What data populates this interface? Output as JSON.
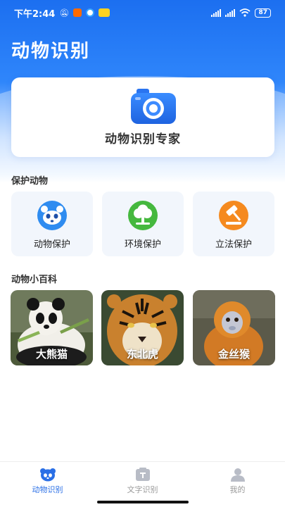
{
  "status_bar": {
    "time": "下午2:44",
    "battery": "87"
  },
  "app": {
    "title": "动物识别"
  },
  "scan": {
    "label": "动物识别专家",
    "icon": "camera-icon"
  },
  "protect_section": {
    "title": "保护动物",
    "items": [
      {
        "label": "动物保护",
        "icon": "panda-face-icon",
        "color": "#2f8cf0"
      },
      {
        "label": "环境保护",
        "icon": "tree-icon",
        "color": "#45b83e"
      },
      {
        "label": "立法保护",
        "icon": "gavel-icon",
        "color": "#f58a1f"
      }
    ]
  },
  "encyclopedia_section": {
    "title": "动物小百科",
    "items": [
      {
        "label": "大熊猫",
        "icon": "panda-photo"
      },
      {
        "label": "东北虎",
        "icon": "tiger-photo"
      },
      {
        "label": "金丝猴",
        "icon": "golden-monkey-photo"
      }
    ]
  },
  "tabbar": {
    "tabs": [
      {
        "label": "动物识别",
        "icon": "panda-tab-icon",
        "active": true
      },
      {
        "label": "文字识别",
        "icon": "text-scan-tab-icon",
        "active": false
      },
      {
        "label": "我的",
        "icon": "user-tab-icon",
        "active": false
      }
    ]
  },
  "colors": {
    "accent": "#2a6fe6",
    "header": "#1c6ff0"
  }
}
